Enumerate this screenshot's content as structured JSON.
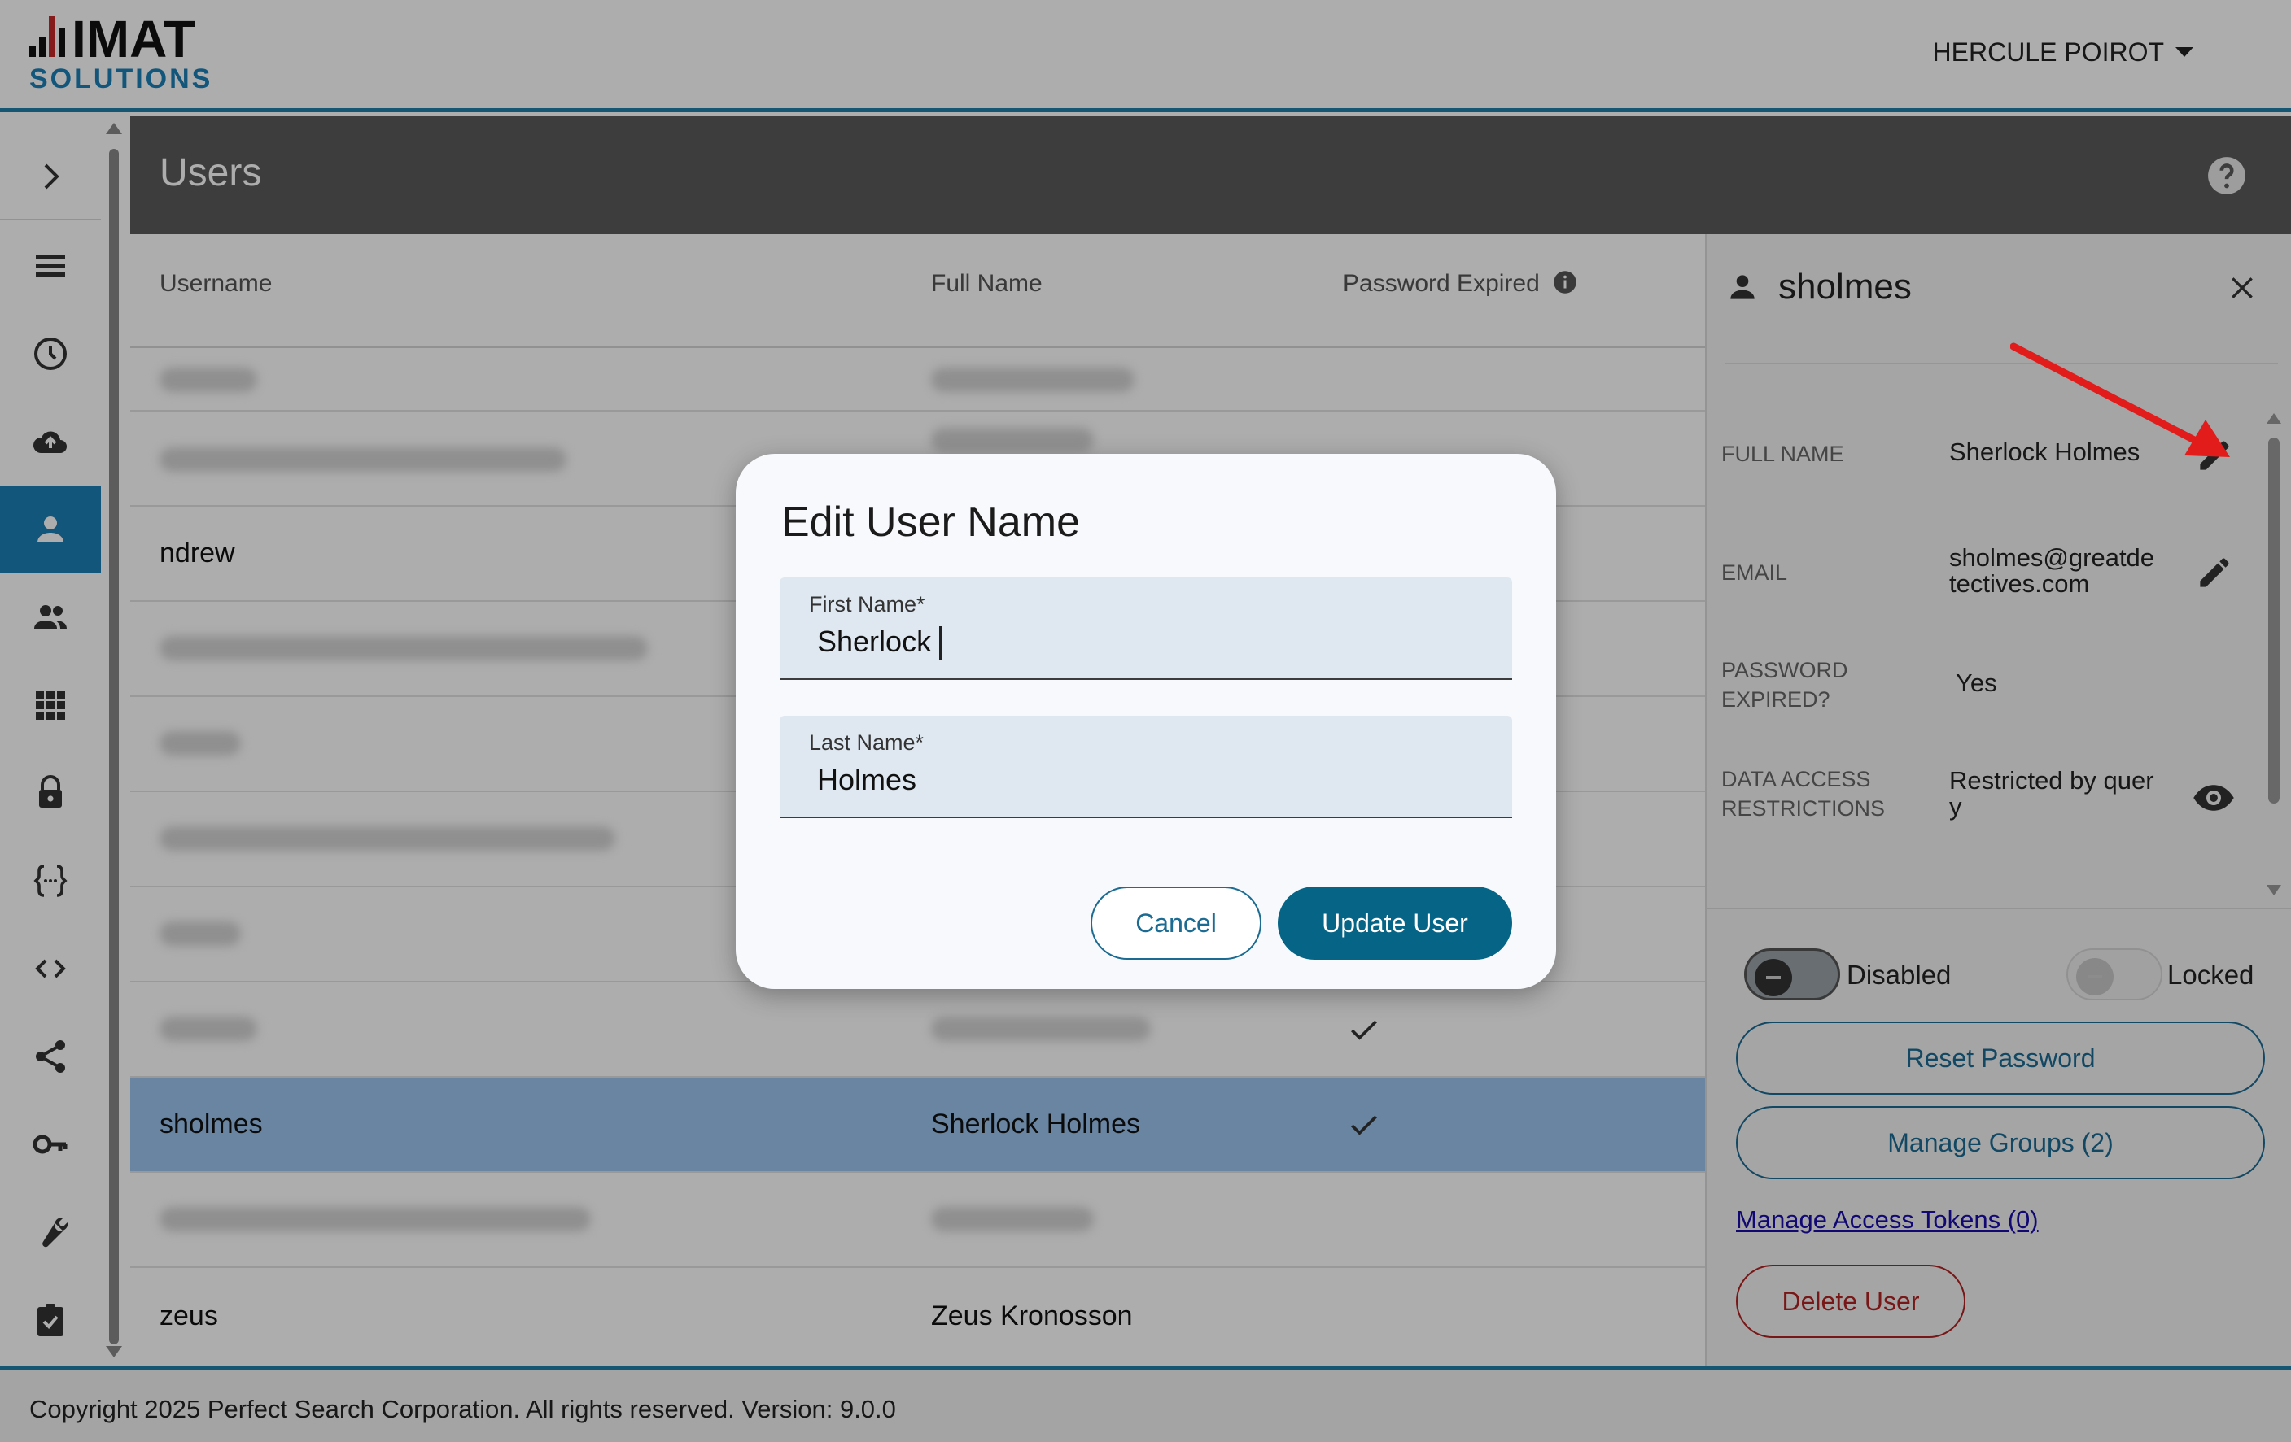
{
  "header": {
    "logo_text": "IMAT",
    "logo_subtext": "SOLUTIONS",
    "user_name": "HERCULE POIROT"
  },
  "sidebar": {
    "items": [
      {
        "icon": "chevron-right-icon"
      },
      {
        "icon": "list-icon"
      },
      {
        "icon": "clock-icon"
      },
      {
        "icon": "cloud-upload-icon"
      },
      {
        "icon": "person-icon",
        "active": true
      },
      {
        "icon": "people-icon"
      },
      {
        "icon": "grid-icon"
      },
      {
        "icon": "lock-icon"
      },
      {
        "icon": "braces-icon"
      },
      {
        "icon": "code-icon"
      },
      {
        "icon": "share-icon"
      },
      {
        "icon": "key-icon"
      },
      {
        "icon": "wrench-icon"
      },
      {
        "icon": "clipboard-check-icon"
      }
    ]
  },
  "page": {
    "title": "Users"
  },
  "table": {
    "headers": {
      "username": "Username",
      "full_name": "Full Name",
      "password_expired": "Password Expired"
    },
    "rows": [
      {
        "username": "",
        "full_name": "",
        "password_expired": false,
        "redacted": true
      },
      {
        "username": "",
        "full_name": "",
        "password_expired": false,
        "redacted": true
      },
      {
        "username": "ndrew",
        "full_name": "",
        "password_expired": false
      },
      {
        "username": "",
        "full_name": "",
        "password_expired": false,
        "redacted": true
      },
      {
        "username": "",
        "full_name": "",
        "password_expired": false,
        "redacted": true
      },
      {
        "username": "",
        "full_name": "",
        "password_expired": false,
        "redacted": true
      },
      {
        "username": "",
        "full_name": "",
        "password_expired": false,
        "redacted": true
      },
      {
        "username": "",
        "full_name": "",
        "password_expired": true,
        "redacted": true
      },
      {
        "username": "sholmes",
        "full_name": "Sherlock Holmes",
        "password_expired": true,
        "selected": true
      },
      {
        "username": "",
        "full_name": "",
        "password_expired": false,
        "redacted": true
      },
      {
        "username": "zeus",
        "full_name": "Zeus Kronosson",
        "password_expired": false
      }
    ]
  },
  "panel": {
    "username": "sholmes",
    "fields": {
      "full_name_label": "FULL NAME",
      "full_name_value": "Sherlock Holmes",
      "email_label": "EMAIL",
      "email_value_line1": "sholmes@greatde",
      "email_value_line2": "tectives.com",
      "password_expired_label_line1": "PASSWORD",
      "password_expired_label_line2": "EXPIRED?",
      "password_expired_value": "Yes",
      "restrictions_label_line1": "DATA ACCESS",
      "restrictions_label_line2": "RESTRICTIONS",
      "restrictions_value_line1": "Restricted by quer",
      "restrictions_value_line2": "y"
    },
    "toggles": {
      "disabled_label": "Disabled",
      "locked_label": "Locked"
    },
    "buttons": {
      "reset_password": "Reset Password",
      "manage_groups": "Manage Groups (2)",
      "manage_tokens": "Manage Access Tokens (0)",
      "delete_user": "Delete User"
    }
  },
  "dialog": {
    "title": "Edit User Name",
    "first_name_label": "First Name*",
    "first_name_value": "Sherlock",
    "last_name_label": "Last Name*",
    "last_name_value": "Holmes",
    "cancel_label": "Cancel",
    "update_label": "Update User"
  },
  "footer": {
    "text": "Copyright 2025 Perfect Search Corporation. All rights reserved. Version: 9.0.0"
  },
  "colors": {
    "accent": "#1d7fb5",
    "primary_button": "#066486",
    "danger": "#b22222",
    "annotation_arrow": "#e21b1b"
  }
}
